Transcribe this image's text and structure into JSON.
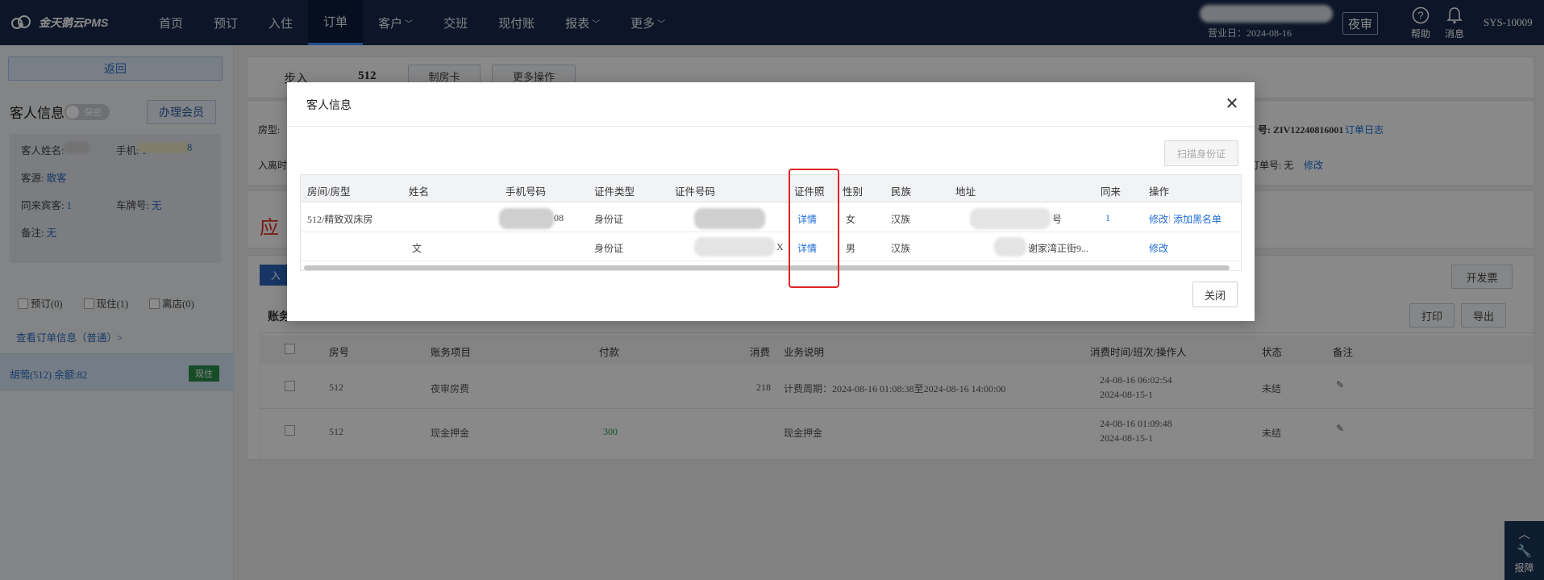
{
  "app": {
    "name": "金天鹅云PMS"
  },
  "nav": [
    {
      "label": "首页",
      "dropdown": false
    },
    {
      "label": "预订",
      "dropdown": false
    },
    {
      "label": "入住",
      "dropdown": false
    },
    {
      "label": "订单",
      "dropdown": false,
      "active": true
    },
    {
      "label": "客户",
      "dropdown": true
    },
    {
      "label": "交班",
      "dropdown": false
    },
    {
      "label": "现付账",
      "dropdown": false
    },
    {
      "label": "报表",
      "dropdown": true
    },
    {
      "label": "更多",
      "dropdown": true
    }
  ],
  "header": {
    "business_date": "营业日：2024-08-16",
    "night_audit": "夜审",
    "help": "帮助",
    "messages": "消息",
    "user": "SYS-10009"
  },
  "sidebar": {
    "back": "返回",
    "guest_info_title": "客人信息",
    "privacy_toggle": "保密",
    "member_button": "办理会员",
    "guest_name_label": "客人姓名:",
    "phone_label": "手机:",
    "phone_partial_start": "1",
    "phone_partial_end": "8",
    "source_label": "客源:",
    "source_value": "散客",
    "companions_label": "同来宾客:",
    "companions_value": "1",
    "plate_label": "车牌号:",
    "plate_value": "无",
    "remark_label": "备注:",
    "remark_value": "无",
    "filters": [
      {
        "label": "预订(0)"
      },
      {
        "label": "现住(1)"
      },
      {
        "label": "离店(0)"
      }
    ],
    "view_order_link": "查看订单信息（普通）>",
    "guest_entry": "胡莺(512)  余额:82",
    "guest_entry_badge": "现住"
  },
  "main": {
    "status_label": "步入",
    "room_no": "512",
    "make_card": "制房卡",
    "more_ops": "更多操作",
    "room_type_label": "房型:",
    "checkin_label": "入离时",
    "order_no": "号: ZIV12240816001",
    "order_log": "订单日志",
    "ext_order_label": "订单号: 无",
    "ext_order_edit": "修改",
    "due_label": "应",
    "in_btn": "入",
    "invoice_btn": "开发票",
    "ledger_label": "账务",
    "print_btn": "打印",
    "export_btn": "导出",
    "table_headers": [
      "房号",
      "账务项目",
      "付款",
      "消费",
      "业务说明",
      "消费时间/班次/操作人",
      "状态",
      "备注"
    ],
    "rows": [
      {
        "room": "512",
        "item": "夜审房费",
        "payment": "",
        "consumption": "218",
        "desc": "计费周期：2024-08-16 01:08:38至2024-08-16 14:00:00",
        "time1": "24-08-16 06:02:54",
        "time2": "2024-08-15-1",
        "status": "未结"
      },
      {
        "room": "512",
        "item": "现金押金",
        "payment": "300",
        "consumption": "",
        "desc": "现金押金",
        "time1": "24-08-16 01:09:48",
        "time2": "2024-08-15-1",
        "status": "未结"
      }
    ]
  },
  "modal": {
    "title": "客人信息",
    "scan_button": "扫描身份证",
    "close_button": "关闭",
    "headers": [
      "房间/房型",
      "姓名",
      "手机号码",
      "证件类型",
      "证件号码",
      "证件照",
      "性别",
      "民族",
      "地址",
      "同来",
      "操作"
    ],
    "rows": [
      {
        "room": "512/精致双床房",
        "name": "",
        "phone_tail": "08",
        "id_type": "身份证",
        "id_tail": "",
        "photo_link": "详情",
        "gender": "女",
        "ethnicity": "汉族",
        "address_tail": "号",
        "companions": "1",
        "edit": "修改",
        "blacklist": "添加黑名单"
      },
      {
        "room": "",
        "name": "文",
        "phone_tail": "",
        "id_type": "身份证",
        "id_tail": "X",
        "photo_link": "详情",
        "gender": "男",
        "ethnicity": "汉族",
        "address_tail": "谢家湾正街9...",
        "companions": "",
        "edit": "修改",
        "blacklist": ""
      }
    ]
  },
  "report": {
    "label": "报障"
  },
  "colors": {
    "topbar": "#16294a",
    "accent": "#1c6bd6",
    "highlight": "#e02424"
  }
}
